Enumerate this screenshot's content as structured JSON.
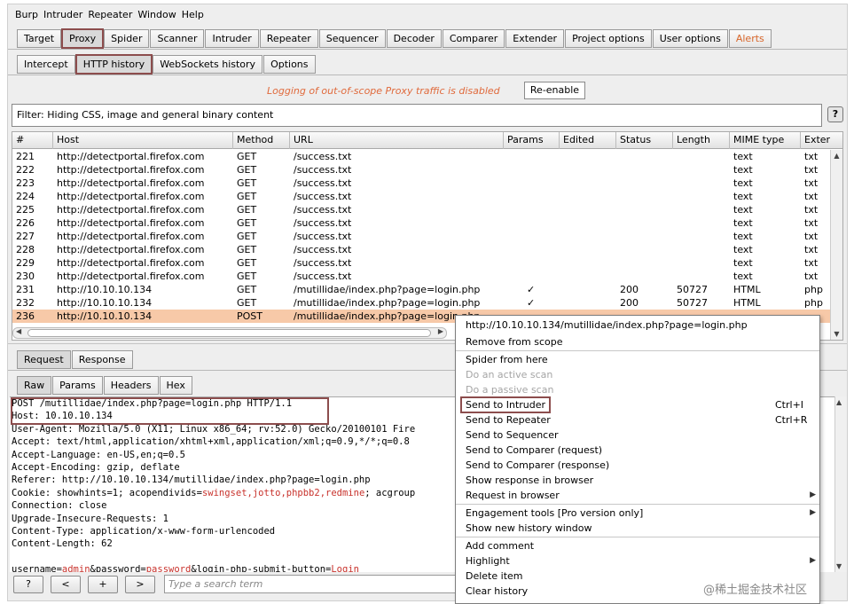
{
  "menu": [
    "Burp",
    "Intruder",
    "Repeater",
    "Window",
    "Help"
  ],
  "main_tabs": [
    {
      "label": "Target"
    },
    {
      "label": "Proxy",
      "active": true
    },
    {
      "label": "Spider"
    },
    {
      "label": "Scanner"
    },
    {
      "label": "Intruder"
    },
    {
      "label": "Repeater"
    },
    {
      "label": "Sequencer"
    },
    {
      "label": "Decoder"
    },
    {
      "label": "Comparer"
    },
    {
      "label": "Extender"
    },
    {
      "label": "Project options"
    },
    {
      "label": "User options"
    },
    {
      "label": "Alerts",
      "alert": true
    }
  ],
  "proxy_tabs": [
    {
      "label": "Intercept"
    },
    {
      "label": "HTTP history",
      "active": true
    },
    {
      "label": "WebSockets history"
    },
    {
      "label": "Options"
    }
  ],
  "logging": {
    "message": "Logging of out-of-scope Proxy traffic is disabled",
    "button": "Re-enable"
  },
  "filter": {
    "text": "Filter: Hiding CSS, image and general binary content",
    "help": "?"
  },
  "table": {
    "columns": [
      "#",
      "Host",
      "Method",
      "URL",
      "Params",
      "Edited",
      "Status",
      "Length",
      "MIME type",
      "Exter"
    ],
    "rows": [
      [
        "221",
        "http://detectportal.firefox.com",
        "GET",
        "/success.txt",
        "",
        "",
        "",
        "",
        "text",
        "txt"
      ],
      [
        "222",
        "http://detectportal.firefox.com",
        "GET",
        "/success.txt",
        "",
        "",
        "",
        "",
        "text",
        "txt"
      ],
      [
        "223",
        "http://detectportal.firefox.com",
        "GET",
        "/success.txt",
        "",
        "",
        "",
        "",
        "text",
        "txt"
      ],
      [
        "224",
        "http://detectportal.firefox.com",
        "GET",
        "/success.txt",
        "",
        "",
        "",
        "",
        "text",
        "txt"
      ],
      [
        "225",
        "http://detectportal.firefox.com",
        "GET",
        "/success.txt",
        "",
        "",
        "",
        "",
        "text",
        "txt"
      ],
      [
        "226",
        "http://detectportal.firefox.com",
        "GET",
        "/success.txt",
        "",
        "",
        "",
        "",
        "text",
        "txt"
      ],
      [
        "227",
        "http://detectportal.firefox.com",
        "GET",
        "/success.txt",
        "",
        "",
        "",
        "",
        "text",
        "txt"
      ],
      [
        "228",
        "http://detectportal.firefox.com",
        "GET",
        "/success.txt",
        "",
        "",
        "",
        "",
        "text",
        "txt"
      ],
      [
        "229",
        "http://detectportal.firefox.com",
        "GET",
        "/success.txt",
        "",
        "",
        "",
        "",
        "text",
        "txt"
      ],
      [
        "230",
        "http://detectportal.firefox.com",
        "GET",
        "/success.txt",
        "",
        "",
        "",
        "",
        "text",
        "txt"
      ],
      [
        "231",
        "http://10.10.10.134",
        "GET",
        "/mutillidae/index.php?page=login.php",
        "✓",
        "",
        "200",
        "50727",
        "HTML",
        "php"
      ],
      [
        "232",
        "http://10.10.10.134",
        "GET",
        "/mutillidae/index.php?page=login.php",
        "✓",
        "",
        "200",
        "50727",
        "HTML",
        "php"
      ],
      [
        "236",
        "http://10.10.10.134",
        "POST",
        "/mutillidae/index.php?page=login.php",
        "",
        "",
        "",
        "",
        "",
        ""
      ]
    ],
    "selected_row": "236"
  },
  "request_tabs": [
    "Request",
    "Response"
  ],
  "view_tabs": [
    "Raw",
    "Params",
    "Headers",
    "Hex"
  ],
  "request": {
    "line1": "POST /mutillidae/index.php?page=login.php HTTP/1.1",
    "line2": "Host: 10.10.10.134",
    "line3": "User-Agent: Mozilla/5.0 (X11; Linux x86_64; rv:52.0) Gecko/20100101 Fire",
    "line4": "Accept: text/html,application/xhtml+xml,application/xml;q=0.9,*/*;q=0.8",
    "line5": "Accept-Language: en-US,en;q=0.5",
    "line6": "Accept-Encoding: gzip, deflate",
    "line7": "Referer: http://10.10.10.134/mutillidae/index.php?page=login.php",
    "cookie_prefix": "Cookie: showhints=1; acopendivids=",
    "cookie_value": "swingset,jotto,phpbb2,redmine",
    "cookie_suffix": "; acgroup",
    "line9": "Connection: close",
    "line10": "Upgrade-Insecure-Requests: 1",
    "line11": "Content-Type: application/x-www-form-urlencoded",
    "line12": "Content-Length: 62",
    "body_k1": "username=",
    "body_v1": "admin",
    "body_k2": "&password=",
    "body_v2": "password",
    "body_k3": "&login-php-submit-button=",
    "body_v3": "Login"
  },
  "bottom": {
    "help": "?",
    "prev": "<",
    "add": "+",
    "next": ">",
    "search_placeholder": "Type a search term"
  },
  "context_menu": {
    "header": "http://10.10.10.134/mutillidae/index.php?page=login.php",
    "remove_scope": "Remove from scope",
    "spider": "Spider from here",
    "active_scan": "Do an active scan",
    "passive_scan": "Do a passive scan",
    "send_intruder": "Send to Intruder",
    "send_intruder_sc": "Ctrl+I",
    "send_repeater": "Send to Repeater",
    "send_repeater_sc": "Ctrl+R",
    "send_sequencer": "Send to Sequencer",
    "send_comparer_req": "Send to Comparer (request)",
    "send_comparer_resp": "Send to Comparer (response)",
    "show_response": "Show response in browser",
    "request_browser": "Request in browser",
    "engagement": "Engagement tools [Pro version only]",
    "new_history": "Show new history window",
    "add_comment": "Add comment",
    "highlight": "Highlight",
    "delete_item": "Delete item",
    "clear_history": "Clear history"
  },
  "watermark": "@稀土掘金技术社区",
  "colors": {
    "accent_box": "#8c4d4d",
    "selected_row": "#f7c9a8",
    "alert_text": "#d8662a",
    "log_text": "#e06a3c"
  }
}
